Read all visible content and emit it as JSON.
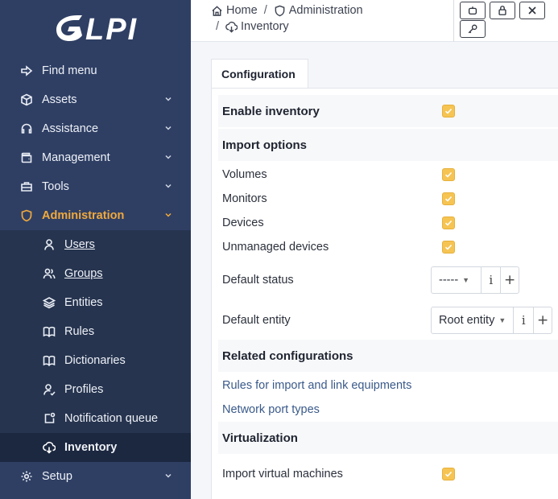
{
  "app": {
    "logo_text": "GLPI"
  },
  "sidebar": {
    "items": [
      {
        "label": "Find menu",
        "icon": "arrow-right-icon"
      },
      {
        "label": "Assets",
        "icon": "cube-icon"
      },
      {
        "label": "Assistance",
        "icon": "headset-icon"
      },
      {
        "label": "Management",
        "icon": "wallet-icon"
      },
      {
        "label": "Tools",
        "icon": "briefcase-icon"
      },
      {
        "label": "Administration",
        "icon": "shield-icon"
      }
    ],
    "sub_items": [
      {
        "label": "Users",
        "icon": "user-icon"
      },
      {
        "label": "Groups",
        "icon": "users-icon"
      },
      {
        "label": "Entities",
        "icon": "stack-icon"
      },
      {
        "label": "Rules",
        "icon": "book-icon"
      },
      {
        "label": "Dictionaries",
        "icon": "book-icon"
      },
      {
        "label": "Profiles",
        "icon": "user-check-icon"
      },
      {
        "label": "Notification queue",
        "icon": "notification-icon"
      },
      {
        "label": "Inventory",
        "icon": "cloud-download-icon"
      }
    ],
    "setup": {
      "label": "Setup",
      "icon": "gear-icon"
    }
  },
  "breadcrumb": {
    "home": "Home",
    "admin": "Administration",
    "current": "Inventory"
  },
  "tab": {
    "label": "Configuration"
  },
  "form": {
    "enable_inventory": "Enable inventory",
    "import_options": "Import options",
    "volumes": "Volumes",
    "monitors": "Monitors",
    "devices": "Devices",
    "unmanaged": "Unmanaged devices",
    "default_status": "Default status",
    "default_status_value": "-----",
    "default_entity": "Default entity",
    "default_entity_value": "Root entity",
    "related": "Related configurations",
    "rules_link": "Rules for import and link equipments",
    "ports_link": "Network port types",
    "virtualization": "Virtualization",
    "import_vm": "Import virtual machines",
    "info_glyph": "i",
    "add_glyph": "+"
  },
  "colors": {
    "sidebar_bg": "#2f3f64",
    "accent": "#f0a93d",
    "checkbox": "#f6c453"
  }
}
